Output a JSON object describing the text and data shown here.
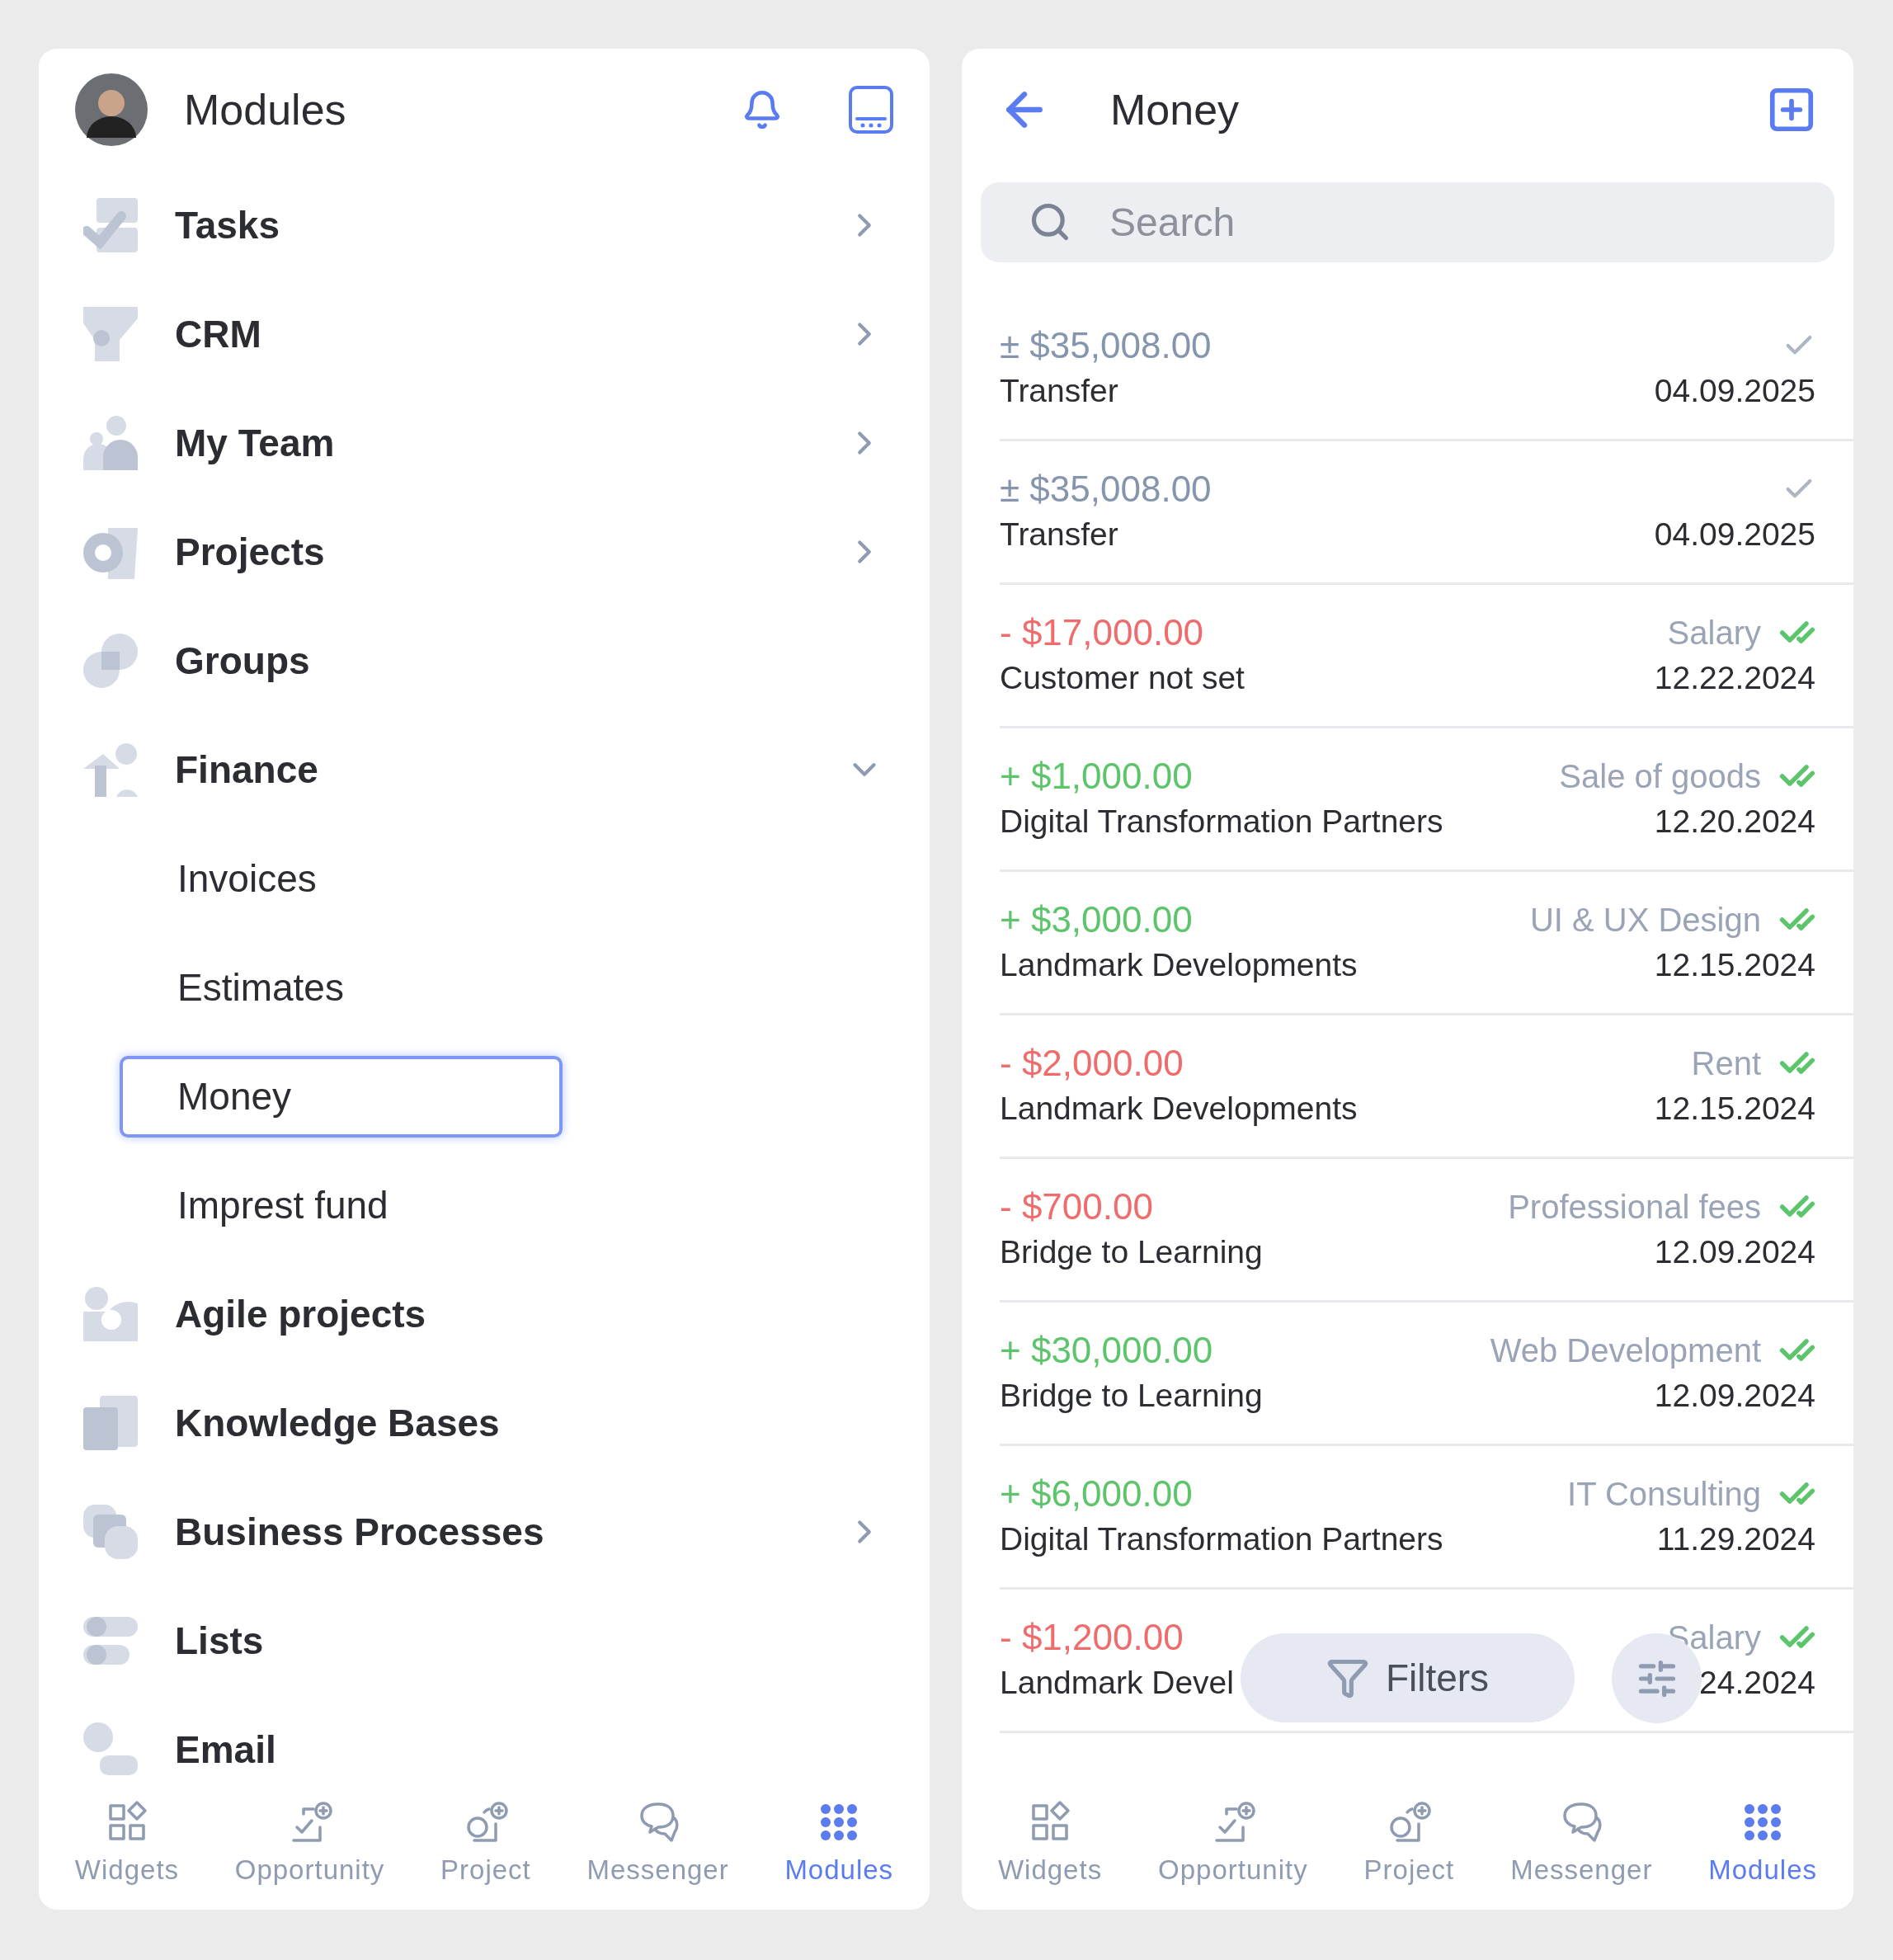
{
  "modules_panel": {
    "title": "Modules",
    "items": [
      {
        "label": "Tasks",
        "expanded": false
      },
      {
        "label": "CRM",
        "expanded": false
      },
      {
        "label": "My Team",
        "expanded": false
      },
      {
        "label": "Projects",
        "expanded": false
      },
      {
        "label": "Groups"
      },
      {
        "label": "Finance",
        "expanded": true,
        "children": [
          {
            "label": "Invoices",
            "selected": false
          },
          {
            "label": "Estimates",
            "selected": false
          },
          {
            "label": "Money",
            "selected": true
          },
          {
            "label": "Imprest fund",
            "selected": false
          }
        ]
      },
      {
        "label": "Agile projects"
      },
      {
        "label": "Knowledge Bases"
      },
      {
        "label": "Business Processes",
        "expanded": false
      },
      {
        "label": "Lists"
      },
      {
        "label": "Email"
      }
    ],
    "nav": [
      {
        "label": "Widgets",
        "selected": false
      },
      {
        "label": "Opportunity",
        "selected": false
      },
      {
        "label": "Project",
        "selected": false
      },
      {
        "label": "Messenger",
        "selected": false
      },
      {
        "label": "Modules",
        "selected": true
      }
    ]
  },
  "money_panel": {
    "title": "Money",
    "search": {
      "placeholder": "Search"
    },
    "transactions": [
      {
        "kind": "transfer",
        "amount": "± $35,008.00",
        "name": "Transfer",
        "date": "04.09.2025",
        "confirmed": false
      },
      {
        "kind": "transfer",
        "amount": "± $35,008.00",
        "name": "Transfer",
        "date": "04.09.2025",
        "confirmed": false
      },
      {
        "kind": "expense",
        "amount": "- $17,000.00",
        "category": "Salary",
        "name": "Customer not set",
        "date": "12.22.2024",
        "confirmed": true
      },
      {
        "kind": "income",
        "amount": "+ $1,000.00",
        "category": "Sale of goods",
        "name": "Digital Transformation Partners",
        "date": "12.20.2024",
        "confirmed": true
      },
      {
        "kind": "income",
        "amount": "+ $3,000.00",
        "category": "UI & UX Design",
        "name": "Landmark Developments",
        "date": "12.15.2024",
        "confirmed": true
      },
      {
        "kind": "expense",
        "amount": "- $2,000.00",
        "category": "Rent",
        "name": "Landmark Developments",
        "date": "12.15.2024",
        "confirmed": true
      },
      {
        "kind": "expense",
        "amount": "- $700.00",
        "category": "Professional fees",
        "name": "Bridge to Learning",
        "date": "12.09.2024",
        "confirmed": true
      },
      {
        "kind": "income",
        "amount": "+ $30,000.00",
        "category": "Web Development",
        "name": "Bridge to Learning",
        "date": "12.09.2024",
        "confirmed": true
      },
      {
        "kind": "income",
        "amount": "+ $6,000.00",
        "category": "IT Consulting",
        "name": "Digital Transformation Partners",
        "date": "11.29.2024",
        "confirmed": true
      },
      {
        "kind": "expense",
        "amount": "- $1,200.00",
        "category": "Salary",
        "name": "Landmark Devel",
        "date": "24.2024",
        "confirmed": true
      }
    ],
    "filters_button": "Filters",
    "nav": [
      {
        "label": "Widgets",
        "selected": false
      },
      {
        "label": "Opportunity",
        "selected": false
      },
      {
        "label": "Project",
        "selected": false
      },
      {
        "label": "Messenger",
        "selected": false
      },
      {
        "label": "Modules",
        "selected": true
      }
    ]
  }
}
